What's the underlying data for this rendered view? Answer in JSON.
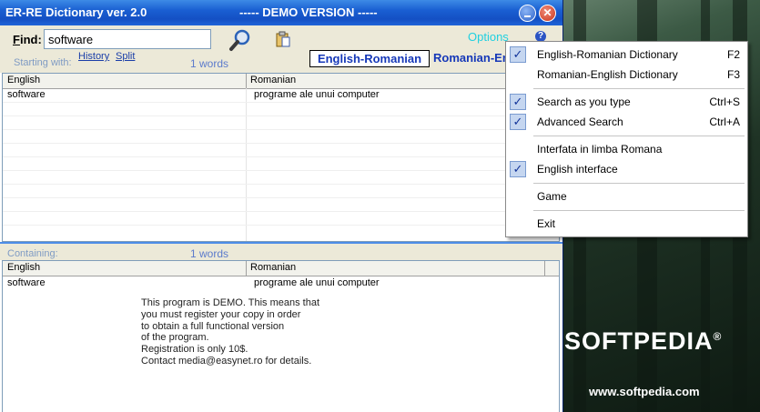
{
  "window": {
    "title": "ER-RE Dictionary ver. 2.0",
    "banner": "----- DEMO VERSION -----",
    "close_glyph": "✕"
  },
  "toolbar": {
    "find_label_prefix": "F",
    "find_label_rest": "ind:",
    "find_value": "software",
    "starting_with": "Starting with:",
    "history_link": "History",
    "split_link": "Split",
    "count": "1 words",
    "dict_en_ro": "English-Romanian",
    "dict_ro_en": "Romanian-English",
    "options_link": "Options",
    "help_glyph": "?"
  },
  "grid_top": {
    "columns": [
      "English",
      "Romanian"
    ],
    "rows": [
      {
        "english": "software",
        "romanian": "programe ale unui computer"
      }
    ]
  },
  "containing": {
    "label": "Containing:",
    "count": "1 words"
  },
  "grid_bottom": {
    "columns": [
      "English",
      "Romanian"
    ],
    "rows": [
      {
        "english": "software",
        "romanian": "programe ale unui computer"
      }
    ]
  },
  "demo_notice": [
    "This program is DEMO. This means that",
    "you must register your copy in order",
    "to obtain a full functional version",
    "of the program.",
    "Registration is only 10$.",
    "Contact media@easynet.ro for details."
  ],
  "menu": {
    "items": [
      {
        "label": "English-Romanian Dictionary",
        "shortcut": "F2",
        "checked": true
      },
      {
        "label": "Romanian-English Dictionary",
        "shortcut": "F3",
        "checked": false
      },
      {
        "label": "Search as you type",
        "shortcut": "Ctrl+S",
        "checked": true
      },
      {
        "label": "Advanced Search",
        "shortcut": "Ctrl+A",
        "checked": true
      },
      {
        "label": "Interfata in limba Romana",
        "shortcut": "",
        "checked": false
      },
      {
        "label": "English interface",
        "shortcut": "",
        "checked": true
      },
      {
        "label": "Game",
        "shortcut": "",
        "checked": false
      },
      {
        "label": "Exit",
        "shortcut": "",
        "checked": false
      }
    ],
    "check_glyph": "✓"
  },
  "watermark": {
    "brand": "SOFTPEDIA",
    "reg": "®",
    "url": "www.softpedia.com"
  },
  "colors": {
    "titlebar": "#1450c4",
    "link": "#1a3ea8",
    "options": "#20d0e0",
    "dict_text": "#1638b8"
  }
}
